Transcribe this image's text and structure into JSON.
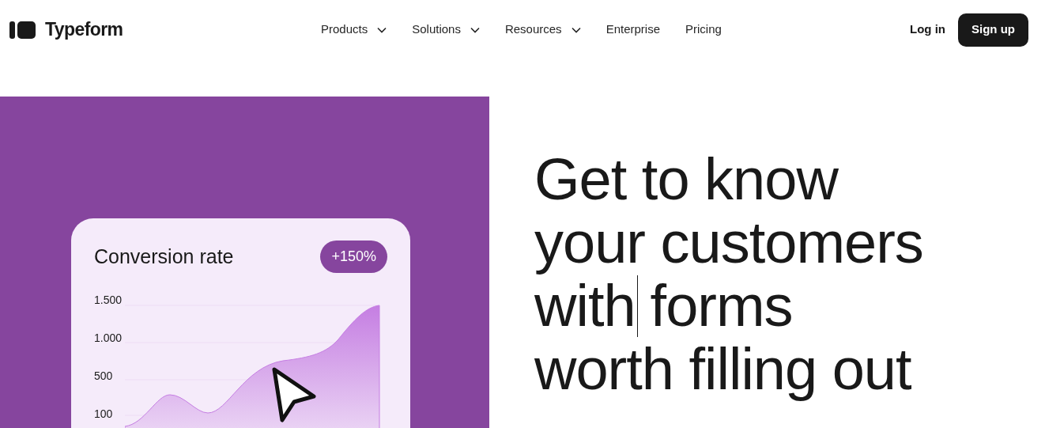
{
  "brand": {
    "name": "Typeform"
  },
  "nav": [
    {
      "label": "Products",
      "dropdown": true
    },
    {
      "label": "Solutions",
      "dropdown": true
    },
    {
      "label": "Resources",
      "dropdown": true
    },
    {
      "label": "Enterprise",
      "dropdown": false
    },
    {
      "label": "Pricing",
      "dropdown": false
    }
  ],
  "actions": {
    "login": "Log in",
    "signup": "Sign up"
  },
  "card": {
    "title": "Conversion rate",
    "badge": "+150%",
    "axis_labels": [
      "1.500",
      "1.000",
      "500",
      "100"
    ]
  },
  "headline": {
    "lines": [
      {
        "parts": [
          "Get to know"
        ],
        "cursor": false
      },
      {
        "parts": [
          "your customers"
        ],
        "cursor": false
      },
      {
        "parts": [
          "with",
          "forms"
        ],
        "cursor": true
      },
      {
        "parts": [
          "worth filling out"
        ],
        "cursor": false
      }
    ]
  }
}
